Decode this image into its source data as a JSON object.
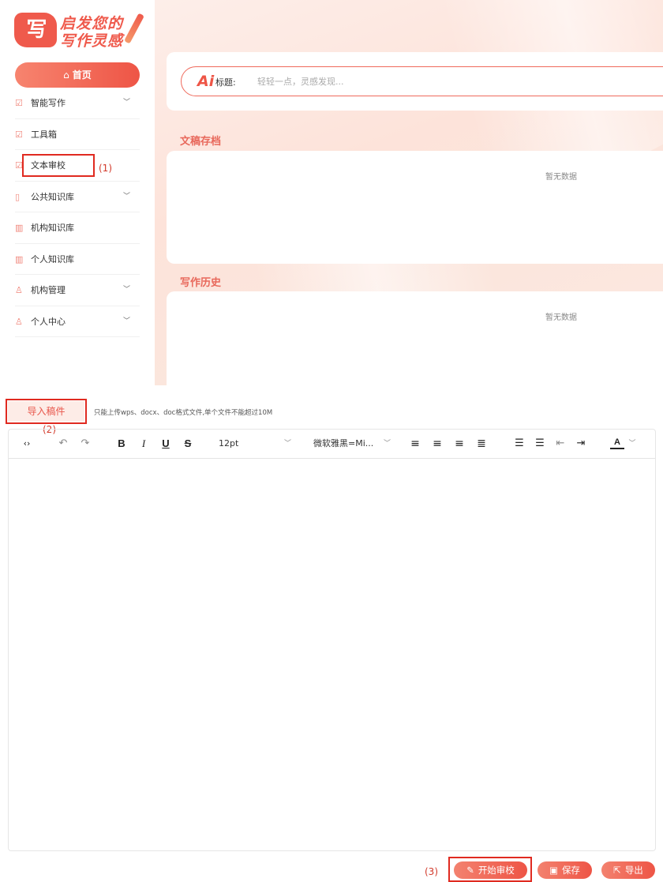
{
  "logo": {
    "mark": "写",
    "line1": "启发您的",
    "line2": "写作灵感"
  },
  "sidebar": {
    "home_label": "首页",
    "items": [
      {
        "label": "智能写作",
        "icon": "edit-icon",
        "expandable": true
      },
      {
        "label": "工具箱",
        "icon": "edit-icon",
        "expandable": false
      },
      {
        "label": "文本审校",
        "icon": "edit-icon",
        "expandable": false
      },
      {
        "label": "公共知识库",
        "icon": "book-icon",
        "expandable": true
      },
      {
        "label": "机构知识库",
        "icon": "library-icon",
        "expandable": false
      },
      {
        "label": "个人知识库",
        "icon": "library-icon",
        "expandable": false
      },
      {
        "label": "机构管理",
        "icon": "user-icon",
        "expandable": true
      },
      {
        "label": "个人中心",
        "icon": "user-icon",
        "expandable": true
      }
    ]
  },
  "search": {
    "ai_mark": "Ai",
    "label": "标题:",
    "placeholder": "轻轻一点，灵感发现..."
  },
  "sections": {
    "archive_title": "文稿存档",
    "archive_empty": "暂无数据",
    "history_title": "写作历史",
    "history_empty": "暂无数据"
  },
  "annotations": {
    "a1": "(1)",
    "a2": "(2)",
    "a3": "(3)"
  },
  "import": {
    "button": "导入稿件",
    "hint": "只能上传wps、docx、doc格式文件,单个文件不能超过10M"
  },
  "editor": {
    "font_size": "12pt",
    "font_family": "微软雅黑=Mi...",
    "bold": "B",
    "italic": "I",
    "underline": "U",
    "strike": "S",
    "text_color": "A"
  },
  "actions": {
    "start_review": "开始审校",
    "save": "保存",
    "export": "导出"
  },
  "colors": {
    "accent": "#ee5546",
    "annotation": "#e02a20"
  }
}
